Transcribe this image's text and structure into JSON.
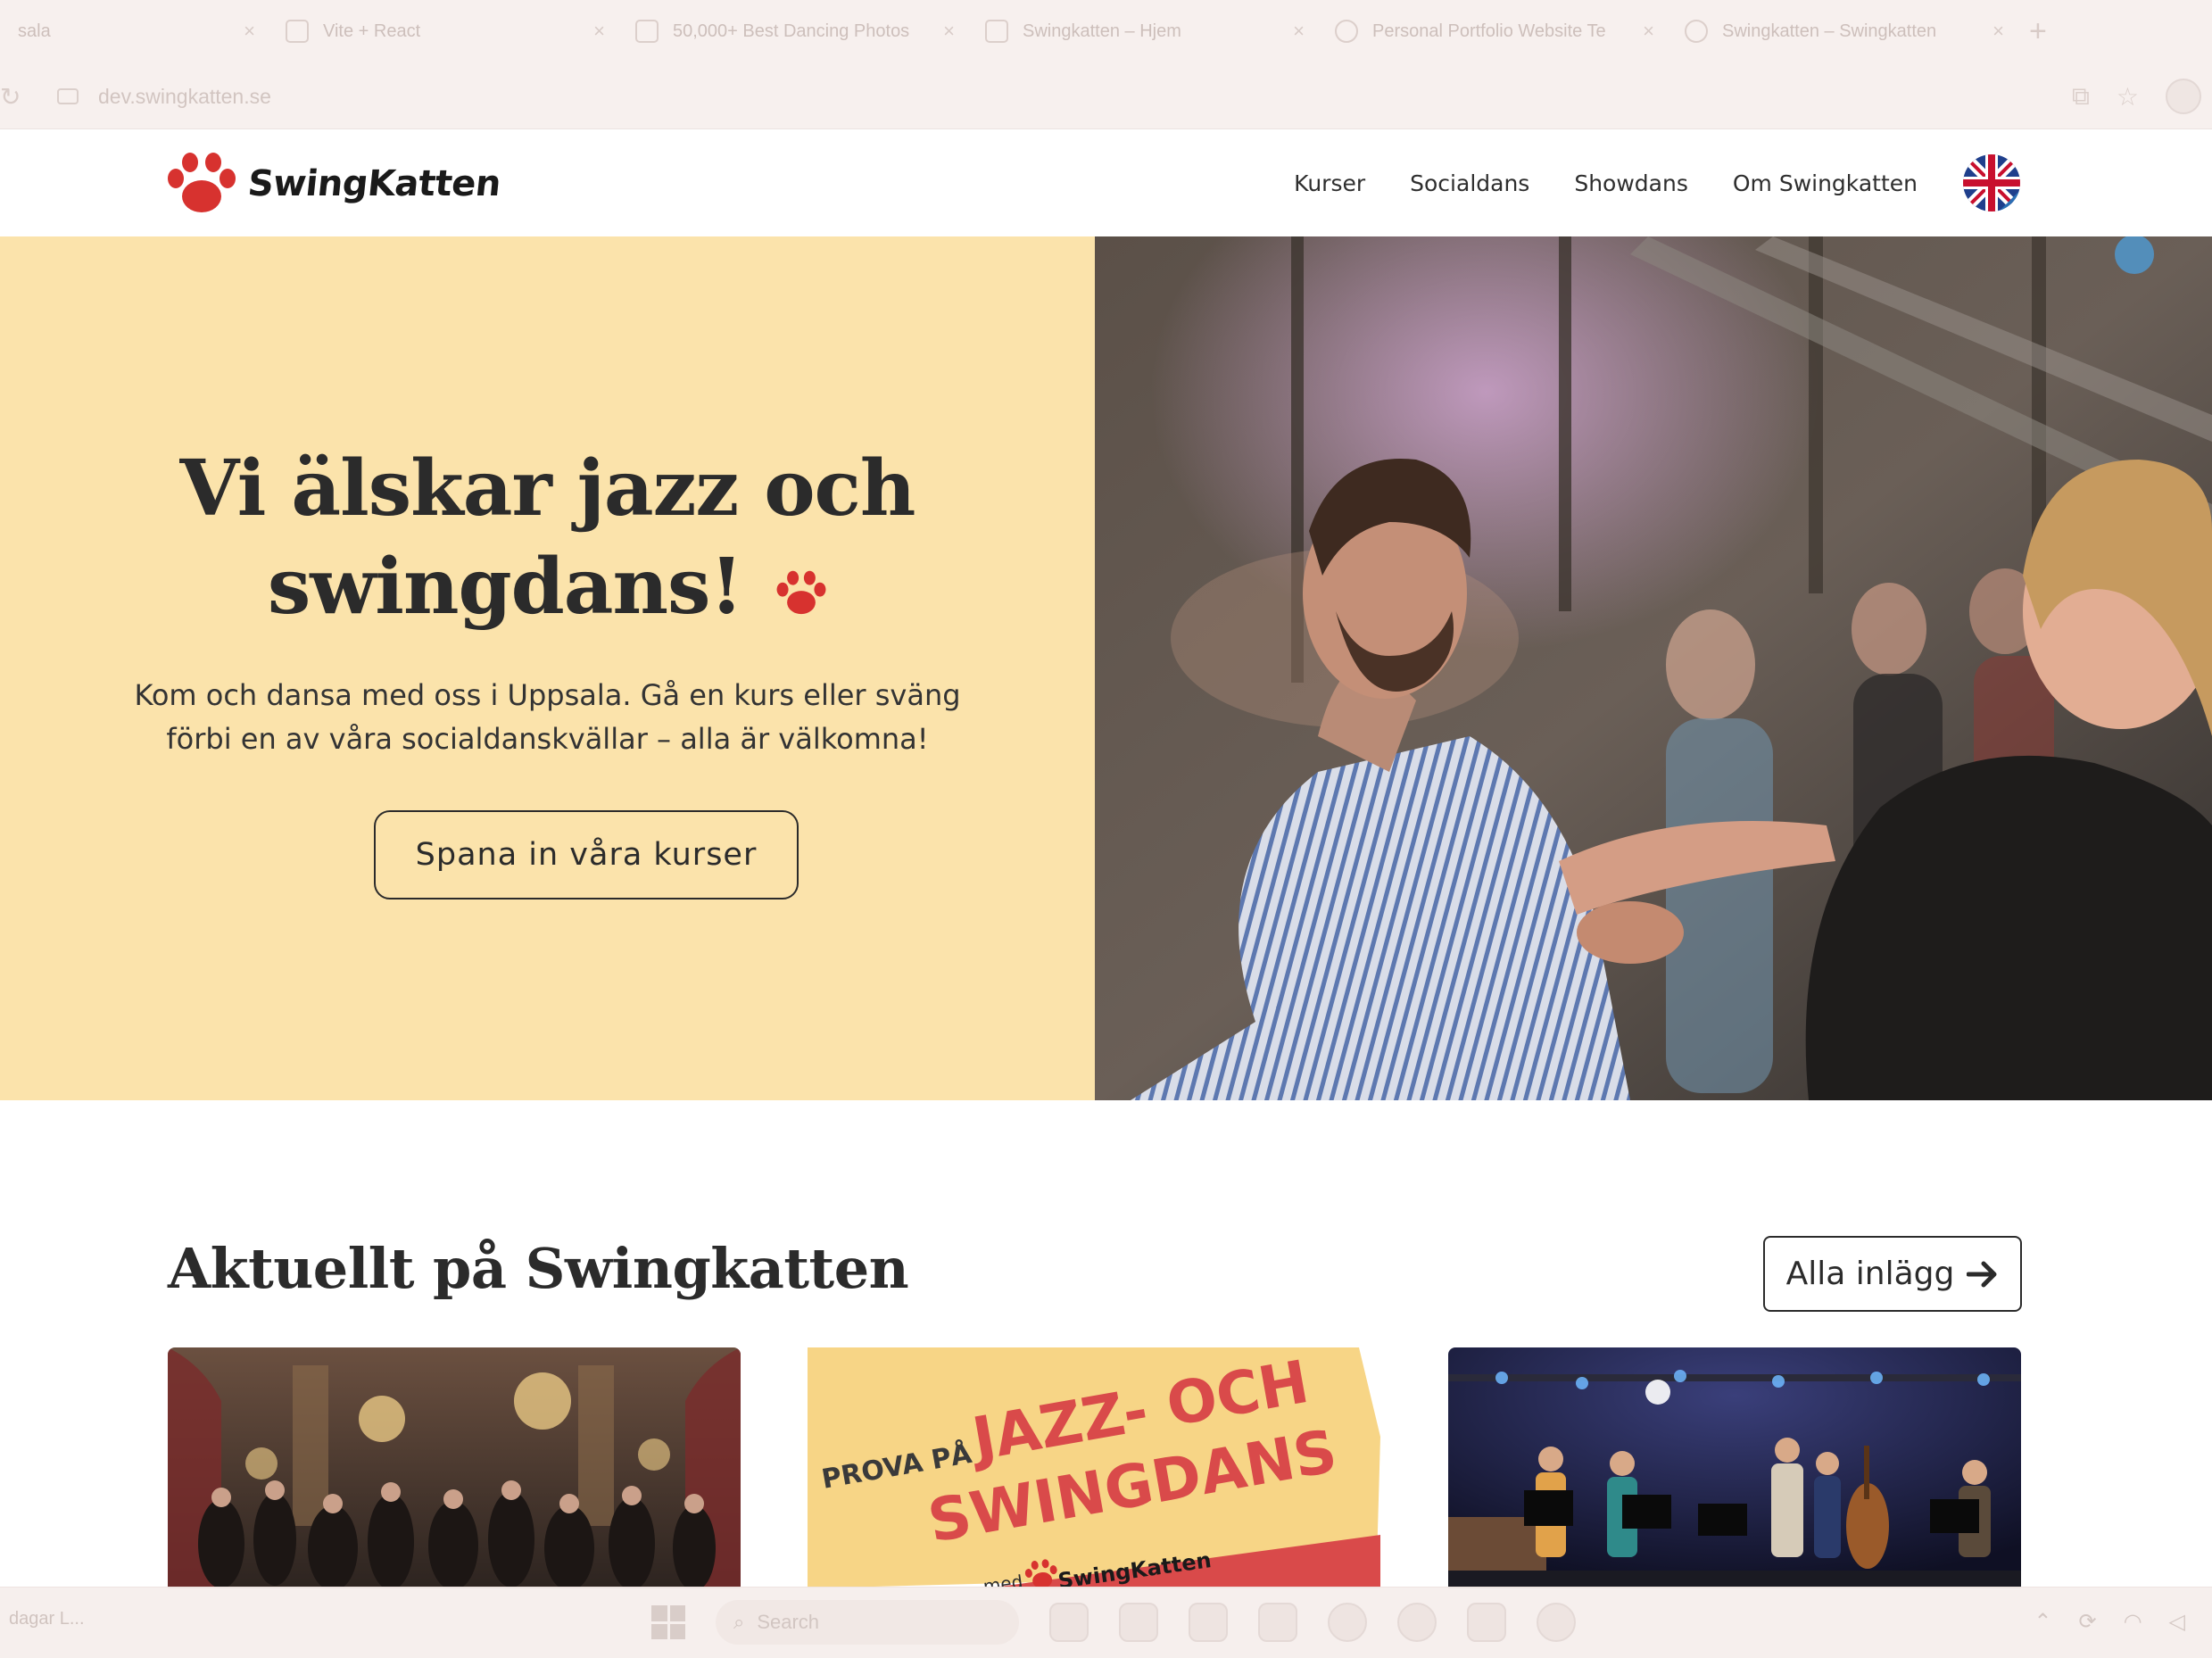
{
  "browser": {
    "tabs": [
      {
        "label": "sala",
        "icon": "page-icon"
      },
      {
        "label": "Vite + React",
        "icon": "vite-icon"
      },
      {
        "label": "50,000+ Best Dancing Photos",
        "icon": "pexels-icon"
      },
      {
        "label": "Swingkatten – Hjem",
        "icon": "page-icon"
      },
      {
        "label": "Personal Portfolio Website Te",
        "icon": "globe-icon"
      },
      {
        "label": "Swingkatten – Swingkatten",
        "icon": "paw-icon"
      }
    ],
    "tab_close": "×",
    "new_tab": "+",
    "url": "dev.swingkatten.se"
  },
  "header": {
    "logo_text": "SwingKatten",
    "nav": [
      "Kurser",
      "Socialdans",
      "Showdans",
      "Om Swingkatten"
    ],
    "language_icon": "uk-sweden-flag-icon"
  },
  "hero": {
    "title_line1": "Vi älskar jazz och",
    "title_line2": "swingdans!",
    "subtitle_line1": "Kom och dansa med oss i Uppsala. Gå en kurs eller sväng",
    "subtitle_line2": "förbi en av våra socialdanskvällar – alla är välkomna!",
    "cta": "Spana in våra kurser",
    "background": "#fbe3ab"
  },
  "news": {
    "title": "Aktuellt på Swingkatten",
    "all_posts": "Alla inlägg",
    "cards": [
      {
        "name": "ballroom-photo"
      },
      {
        "name": "prova-pa-poster",
        "pre": "PROVA PÅ",
        "line1": "JAZZ- OCH",
        "line2": "SWINGDANS",
        "footer_prefix": "med",
        "footer_logo": "SwingKatten"
      },
      {
        "name": "jazz-band-photo"
      }
    ]
  },
  "taskbar": {
    "weather": "dagar L...",
    "search_placeholder": "Search"
  },
  "colors": {
    "accent_red": "#d7322f",
    "hero_yellow": "#fbe3ab",
    "text_dark": "#2b2b2b"
  }
}
